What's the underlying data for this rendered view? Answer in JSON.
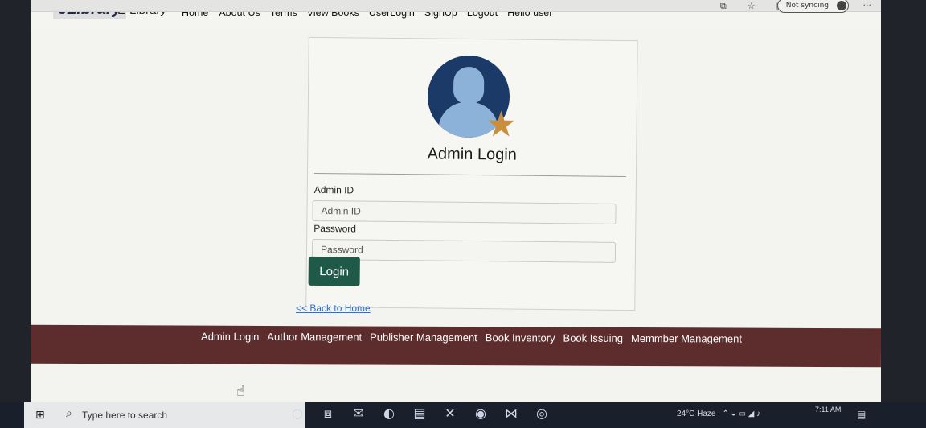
{
  "browser": {
    "sync_label": "Not syncing",
    "icons": [
      "reader-icon",
      "favorites-icon",
      "collections-icon"
    ],
    "more_label": "···"
  },
  "navbar": {
    "logo": "eLibrary",
    "brand": "E-Library",
    "links": [
      "Home",
      "About Us",
      "Terms",
      "View Books",
      "UserLogin",
      "SignUp",
      "Logout",
      "Hello user"
    ]
  },
  "login": {
    "title": "Admin Login",
    "admin_id_label": "Admin ID",
    "admin_id_placeholder": "Admin ID",
    "password_label": "Password",
    "password_placeholder": "Password",
    "button": "Login",
    "back_link": "<< Back to Home"
  },
  "footer": {
    "links": [
      "Admin Login",
      "Author Management",
      "Publisher Management",
      "Book Inventory",
      "Book Issuing",
      "Memmber Management"
    ]
  },
  "taskbar": {
    "search_placeholder": "Type here to search",
    "weather": "24°C Haze",
    "time": "7:11 AM"
  },
  "colors": {
    "footer_bg": "#5d2d2e",
    "login_button": "#1e5a47",
    "avatar_bg": "#1b3a67",
    "star": "#c98f3d",
    "link": "#2d6fd2"
  }
}
